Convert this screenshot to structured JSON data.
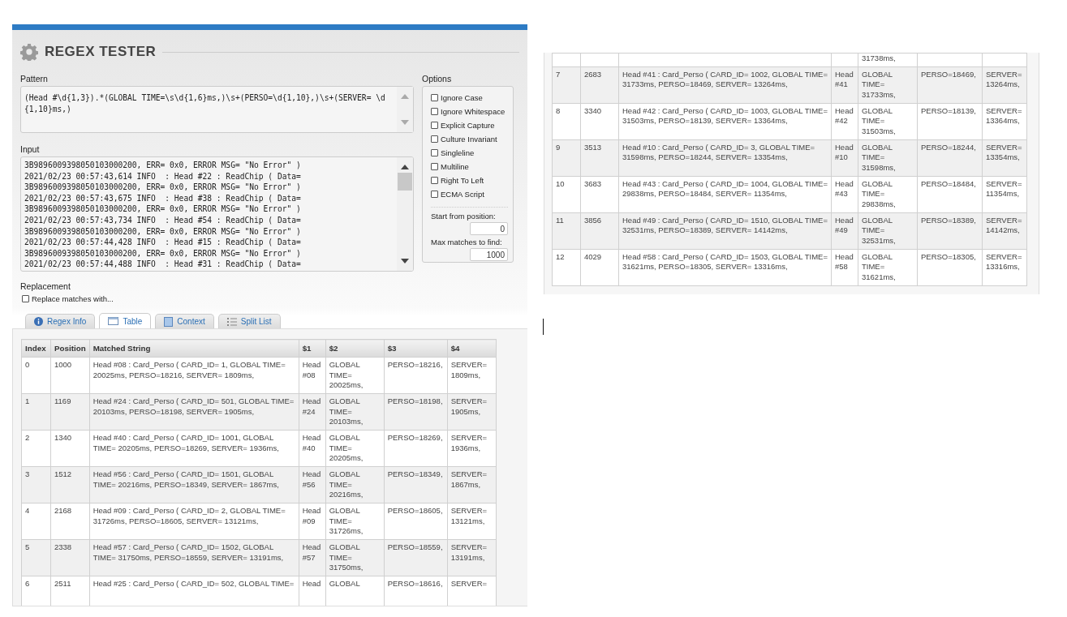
{
  "title": "REGEX TESTER",
  "pattern": {
    "label": "Pattern",
    "value": "(Head #\\d{1,3}).*(GLOBAL TIME=\\s\\d{1,6}ms,)\\s+(PERSO=\\d{1,10},)\\s+(SERVER= \\d{1,10}ms,)"
  },
  "input": {
    "label": "Input",
    "lines": [
      "3B9896009398050103000200, ERR= 0x0, ERROR MSG= \"No Error\" )",
      "2021/02/23 00:57:43,614 INFO  : Head #22 : ReadChip ( Data=",
      "3B9896009398050103000200, ERR= 0x0, ERROR MSG= \"No Error\" )",
      "2021/02/23 00:57:43,675 INFO  : Head #38 : ReadChip ( Data=",
      "3B9896009398050103000200, ERR= 0x0, ERROR MSG= \"No Error\" )",
      "2021/02/23 00:57:43,734 INFO  : Head #54 : ReadChip ( Data=",
      "3B9896009398050103000200, ERR= 0x0, ERROR MSG= \"No Error\" )",
      "2021/02/23 00:57:44,428 INFO  : Head #15 : ReadChip ( Data=",
      "3B9896009398050103000200, ERR= 0x0, ERROR MSG= \"No Error\" )",
      "2021/02/23 00:57:44,488 INFO  : Head #31 : ReadChip ( Data="
    ]
  },
  "options": {
    "label": "Options",
    "items": [
      {
        "label": "Ignore Case",
        "checked": false
      },
      {
        "label": "Ignore Whitespace",
        "checked": false
      },
      {
        "label": "Explicit Capture",
        "checked": false
      },
      {
        "label": "Culture Invariant",
        "checked": false
      },
      {
        "label": "Singleline",
        "checked": false
      },
      {
        "label": "Multiline",
        "checked": false
      },
      {
        "label": "Right To Left",
        "checked": false
      },
      {
        "label": "ECMA Script",
        "checked": false
      }
    ],
    "start_label": "Start from position:",
    "start_value": "0",
    "max_label": "Max matches to find:",
    "max_value": "1000"
  },
  "replacement": {
    "label": "Replacement",
    "checkbox_label": "Replace matches with...",
    "checked": false
  },
  "tabs": [
    {
      "label": "Regex Info",
      "selected": false
    },
    {
      "label": "Table",
      "selected": true
    },
    {
      "label": "Context",
      "selected": false
    },
    {
      "label": "Split List",
      "selected": false
    }
  ],
  "table": {
    "columns": [
      "Index",
      "Position",
      "Matched String",
      "$1",
      "$2",
      "$3",
      "$4"
    ],
    "rows": [
      [
        "0",
        "1000",
        "Head #08 : Card_Perso ( CARD_ID= 1, GLOBAL TIME= 20025ms, PERSO=18216, SERVER= 1809ms,",
        "Head #08",
        "GLOBAL TIME= 20025ms,",
        "PERSO=18216,",
        "SERVER= 1809ms,"
      ],
      [
        "1",
        "1169",
        "Head #24 : Card_Perso ( CARD_ID= 501, GLOBAL TIME= 20103ms, PERSO=18198, SERVER= 1905ms,",
        "Head #24",
        "GLOBAL TIME= 20103ms,",
        "PERSO=18198,",
        "SERVER= 1905ms,"
      ],
      [
        "2",
        "1340",
        "Head #40 : Card_Perso ( CARD_ID= 1001, GLOBAL TIME= 20205ms, PERSO=18269, SERVER= 1936ms,",
        "Head #40",
        "GLOBAL TIME= 20205ms,",
        "PERSO=18269,",
        "SERVER= 1936ms,"
      ],
      [
        "3",
        "1512",
        "Head #56 : Card_Perso ( CARD_ID= 1501, GLOBAL TIME= 20216ms, PERSO=18349, SERVER= 1867ms,",
        "Head #56",
        "GLOBAL TIME= 20216ms,",
        "PERSO=18349,",
        "SERVER= 1867ms,"
      ],
      [
        "4",
        "2168",
        "Head #09 : Card_Perso ( CARD_ID= 2, GLOBAL TIME= 31726ms, PERSO=18605, SERVER= 13121ms,",
        "Head #09",
        "GLOBAL TIME= 31726ms,",
        "PERSO=18605,",
        "SERVER= 13121ms,"
      ],
      [
        "5",
        "2338",
        "Head #57 : Card_Perso ( CARD_ID= 1502, GLOBAL TIME= 31750ms, PERSO=18559, SERVER= 13191ms,",
        "Head #57",
        "GLOBAL TIME= 31750ms,",
        "PERSO=18559,",
        "SERVER= 13191ms,"
      ],
      [
        "6",
        "2511",
        "Head #25 : Card_Perso ( CARD_ID= 502, GLOBAL TIME=",
        "Head",
        "GLOBAL",
        "PERSO=18616,",
        "SERVER="
      ]
    ]
  },
  "table_continued": {
    "rows": [
      [
        "",
        "",
        "",
        "",
        "31738ms,",
        "",
        ""
      ],
      [
        "7",
        "2683",
        "Head #41 : Card_Perso ( CARD_ID= 1002, GLOBAL TIME= 31733ms, PERSO=18469, SERVER= 13264ms,",
        "Head #41",
        "GLOBAL TIME= 31733ms,",
        "PERSO=18469,",
        "SERVER= 13264ms,"
      ],
      [
        "8",
        "3340",
        "Head #42 : Card_Perso ( CARD_ID= 1003, GLOBAL TIME= 31503ms, PERSO=18139, SERVER= 13364ms,",
        "Head #42",
        "GLOBAL TIME= 31503ms,",
        "PERSO=18139,",
        "SERVER= 13364ms,"
      ],
      [
        "9",
        "3513",
        "Head #10 : Card_Perso ( CARD_ID= 3, GLOBAL TIME= 31598ms, PERSO=18244, SERVER= 13354ms,",
        "Head #10",
        "GLOBAL TIME= 31598ms,",
        "PERSO=18244,",
        "SERVER= 13354ms,"
      ],
      [
        "10",
        "3683",
        "Head #43 : Card_Perso ( CARD_ID= 1004, GLOBAL TIME= 29838ms, PERSO=18484, SERVER= 11354ms,",
        "Head #43",
        "GLOBAL TIME= 29838ms,",
        "PERSO=18484,",
        "SERVER= 11354ms,"
      ],
      [
        "11",
        "3856",
        "Head #49 : Card_Perso ( CARD_ID= 1510, GLOBAL TIME= 32531ms, PERSO=18389, SERVER= 14142ms,",
        "Head #49",
        "GLOBAL TIME= 32531ms,",
        "PERSO=18389,",
        "SERVER= 14142ms,"
      ],
      [
        "12",
        "4029",
        "Head #58 : Card_Perso ( CARD_ID= 1503, GLOBAL TIME= 31621ms, PERSO=18305, SERVER= 13316ms,",
        "Head #58",
        "GLOBAL TIME= 31621ms,",
        "PERSO=18305,",
        "SERVER= 13316ms,"
      ]
    ]
  }
}
